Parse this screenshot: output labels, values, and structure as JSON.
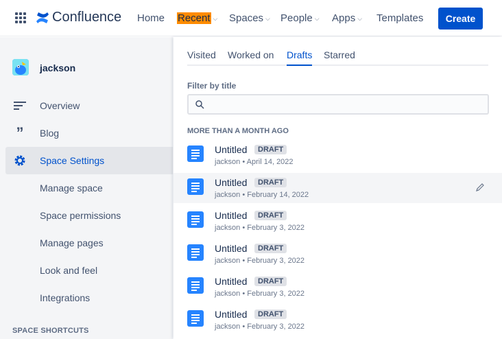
{
  "nav": {
    "brand": "Confluence",
    "items": [
      {
        "label": "Home",
        "chevron": false
      },
      {
        "label": "Recent",
        "chevron": true
      },
      {
        "label": "Spaces",
        "chevron": true
      },
      {
        "label": "People",
        "chevron": true
      },
      {
        "label": "Apps",
        "chevron": true
      },
      {
        "label": "Templates",
        "chevron": false
      }
    ],
    "create_label": "Create"
  },
  "sidebar": {
    "space_name": "jackson",
    "items": [
      {
        "label": "Overview",
        "icon": "overview-icon"
      },
      {
        "label": "Blog",
        "icon": "blog-quote-icon"
      },
      {
        "label": "Space Settings",
        "icon": "gear-icon",
        "active": true
      },
      {
        "label": "Manage space"
      },
      {
        "label": "Space permissions"
      },
      {
        "label": "Manage pages"
      },
      {
        "label": "Look and feel"
      },
      {
        "label": "Integrations"
      }
    ],
    "shortcuts_heading": "SPACE SHORTCUTS"
  },
  "panel": {
    "tabs": [
      "Visited",
      "Worked on",
      "Drafts",
      "Starred"
    ],
    "active_tab": "Drafts",
    "filter_label": "Filter by title",
    "filter_placeholder": "",
    "section_heading": "MORE THAN A MONTH AGO",
    "drafts": [
      {
        "title": "Untitled",
        "badge": "DRAFT",
        "author": "jackson",
        "date": "April 14, 2022"
      },
      {
        "title": "Untitled",
        "badge": "DRAFT",
        "author": "jackson",
        "date": "February 14, 2022",
        "hover": true
      },
      {
        "title": "Untitled",
        "badge": "DRAFT",
        "author": "jackson",
        "date": "February 3, 2022"
      },
      {
        "title": "Untitled",
        "badge": "DRAFT",
        "author": "jackson",
        "date": "February 3, 2022"
      },
      {
        "title": "Untitled",
        "badge": "DRAFT",
        "author": "jackson",
        "date": "February 3, 2022"
      },
      {
        "title": "Untitled",
        "badge": "DRAFT",
        "author": "jackson",
        "date": "February 3, 2022"
      }
    ]
  },
  "colors": {
    "accent": "#0052CC",
    "highlight": "#FF8B00",
    "doc_icon": "#2684FF"
  }
}
